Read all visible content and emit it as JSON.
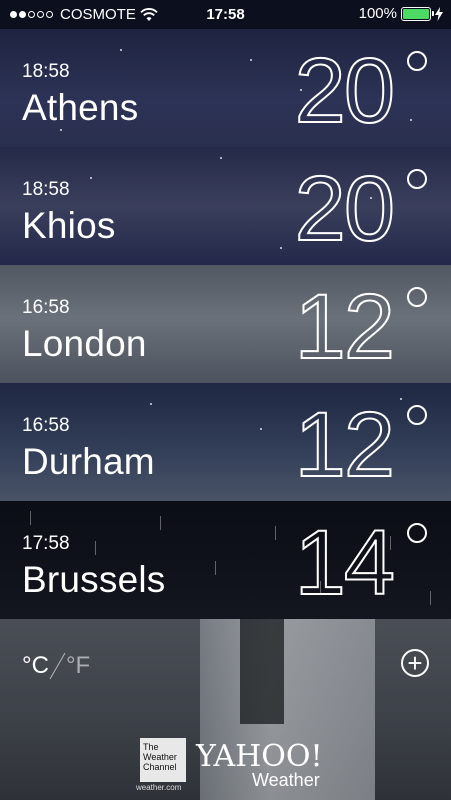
{
  "status_bar": {
    "carrier": "COSMOTE",
    "time": "17:58",
    "battery": "100%",
    "signal_bars_filled": 2,
    "signal_bars_total": 5
  },
  "cities": [
    {
      "local_time": "18:58",
      "name": "Athens",
      "temperature": "20"
    },
    {
      "local_time": "18:58",
      "name": "Khios",
      "temperature": "20"
    },
    {
      "local_time": "16:58",
      "name": "London",
      "temperature": "12"
    },
    {
      "local_time": "16:58",
      "name": "Durham",
      "temperature": "12"
    },
    {
      "local_time": "17:58",
      "name": "Brussels",
      "temperature": "14"
    }
  ],
  "footer": {
    "unit_celsius": "°C",
    "unit_fahrenheit": "°F",
    "add_symbol": "+",
    "twc_logo_text": "The Weather Channel",
    "twc_url": "weather.com",
    "yahoo_text": "YAHOO!",
    "weather_text": "Weather"
  },
  "colors": {
    "battery": "#4cd964",
    "text": "#ffffff"
  }
}
